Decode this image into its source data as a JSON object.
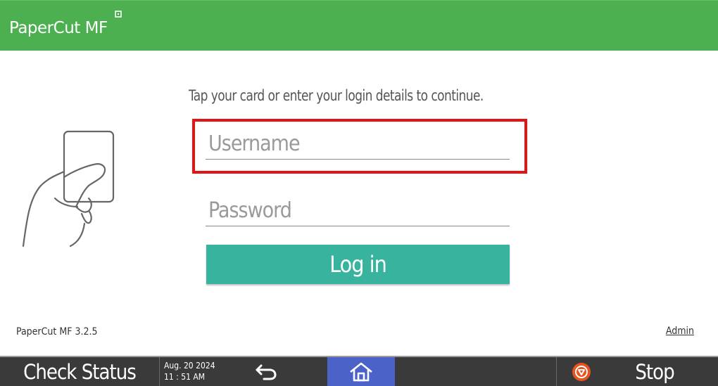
{
  "header": {
    "brand": "PaperCut MF",
    "brand_color": "#4caf50"
  },
  "main": {
    "prompt": "Tap your card or enter your login details to continue.",
    "username_placeholder": "Username",
    "password_placeholder": "Password",
    "login_label": "Log in",
    "login_color": "#37b39e",
    "version": "PaperCut MF 3.2.5",
    "admin_label": "Admin",
    "card_icon": "hand-holding-card-icon"
  },
  "bottom_bar": {
    "check_status_label": "Check Status",
    "date": "Aug. 20 2024",
    "time": "11 : 51 AM",
    "back_icon": "back-arrow-icon",
    "home_icon": "home-icon",
    "stop_icon": "stop-icon",
    "stop_label": "Stop",
    "home_color": "#4b63c9",
    "stop_color": "#e8541e"
  }
}
